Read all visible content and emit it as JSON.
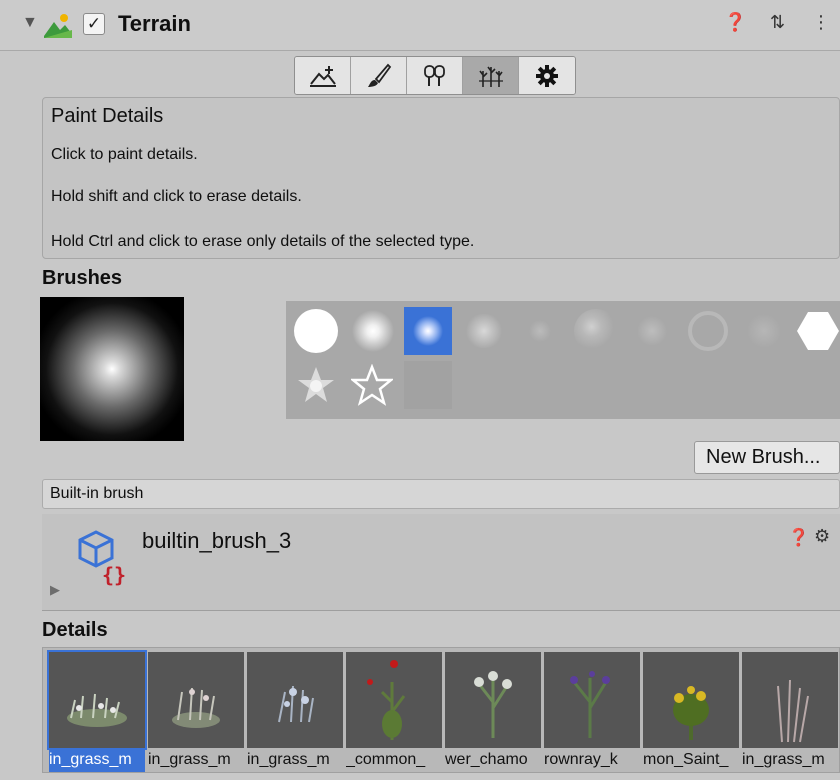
{
  "inspector": {
    "component_title": "Terrain",
    "enabled": true,
    "foldout_glyph": "▼",
    "help_glyph": "❓",
    "presets_glyph": "⇅",
    "menu_glyph": "⋮"
  },
  "toolbar": {
    "tools": [
      {
        "icon": "raise-terrain-icon"
      },
      {
        "icon": "paint-brush-icon"
      },
      {
        "icon": "paint-trees-icon"
      },
      {
        "icon": "paint-details-icon",
        "active": true
      },
      {
        "icon": "settings-gear-icon"
      }
    ]
  },
  "help_box": {
    "title": "Paint Details",
    "lines": [
      "Click to paint details.",
      "Hold shift and click to erase details.",
      "Hold Ctrl and click to erase only details of the selected type."
    ]
  },
  "brushes": {
    "label": "Brushes",
    "new_brush_label": "New Brush...",
    "selected_index": 2,
    "builtin_label": "Built-in brush"
  },
  "brush_asset": {
    "name": "builtin_brush_3",
    "help_glyph": "❓",
    "gear_glyph": "⚙",
    "fold_glyph": "▶"
  },
  "details": {
    "label": "Details",
    "items": [
      {
        "label": "in_grass_m",
        "selected": true
      },
      {
        "label": "in_grass_m"
      },
      {
        "label": "in_grass_m"
      },
      {
        "label": "_common_"
      },
      {
        "label": "wer_chamo"
      },
      {
        "label": "rownray_k"
      },
      {
        "label": "mon_Saint_"
      },
      {
        "label": "in_grass_m"
      }
    ]
  },
  "colors": {
    "selection_blue": "#3a72d6",
    "panel_gray": "#c8c8c8"
  }
}
